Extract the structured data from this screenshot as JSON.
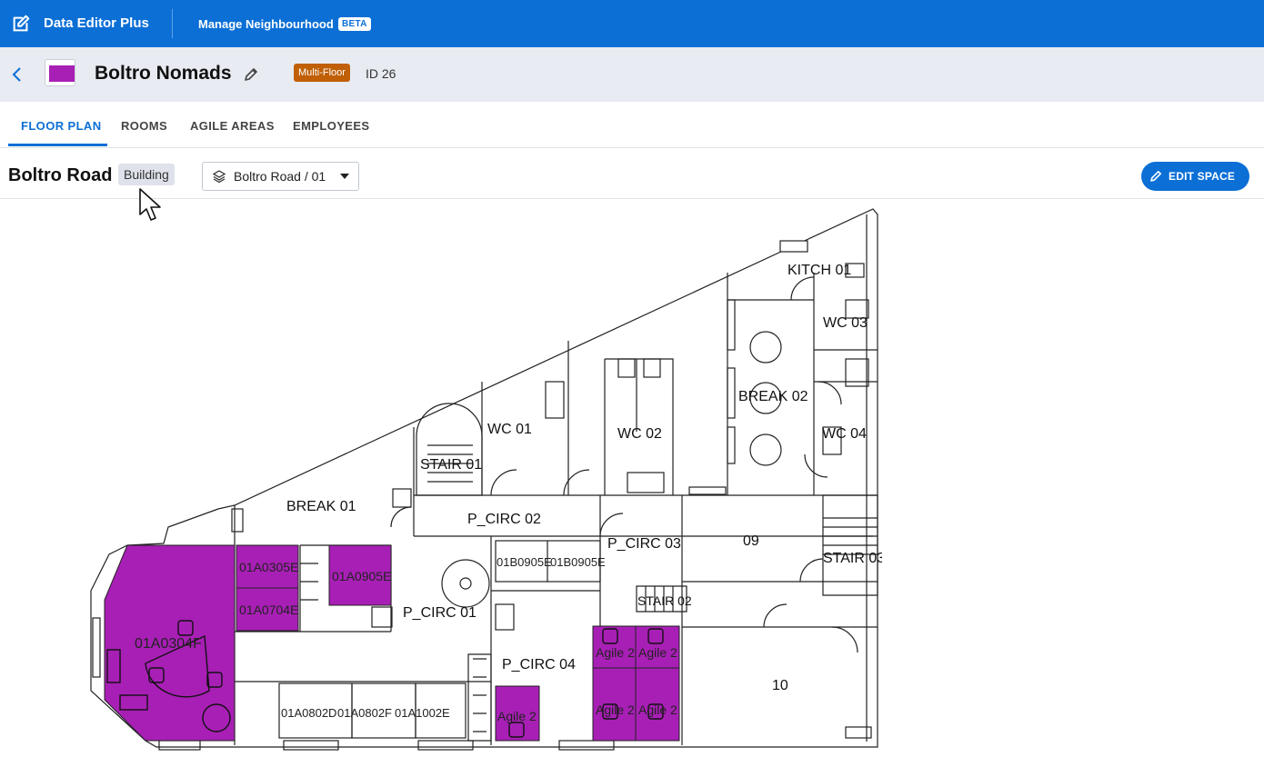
{
  "topbar": {
    "app_title": "Data Editor Plus",
    "nav_item": "Manage Neighbourhood",
    "beta_badge": "BETA",
    "bg_color": "#0b6fd6"
  },
  "header": {
    "title": "Boltro Nomads",
    "swatch_color": "#a81fb5",
    "type_badge": "Multi-Floor",
    "id_label": "ID 26"
  },
  "tabs": [
    {
      "label": "FLOOR PLAN",
      "active": true
    },
    {
      "label": "ROOMS",
      "active": false
    },
    {
      "label": "AGILE AREAS",
      "active": false
    },
    {
      "label": "EMPLOYEES",
      "active": false
    }
  ],
  "subbar": {
    "building_name": "Boltro Road",
    "building_chip": "Building",
    "floor_selector": "Boltro Road / 01",
    "edit_button": "EDIT SPACE"
  },
  "floorplan": {
    "highlight_color": "#a81fb5",
    "rooms": {
      "kitch01": "KITCH 01",
      "wc03": "WC 03",
      "break02": "BREAK 02",
      "wc04": "WC 04",
      "wc01": "WC 01",
      "wc02": "WC 02",
      "stair01": "STAIR 01",
      "break01": "BREAK 01",
      "pcirc02": "P_CIRC 02",
      "pcirc03": "P_CIRC 03",
      "r09": "09",
      "stair03": "STAIR 03",
      "stair02": "STAIR 02",
      "pcirc01": "P_CIRC 01",
      "pcirc04": "P_CIRC 04",
      "r10": "10"
    },
    "desks": {
      "d01A0305E": "01A0305E",
      "d01A0704E": "01A0704E",
      "d01A0905E": "01A0905E",
      "d01A0304F": "01A0304F",
      "d01B0905E_1": "01B0905E",
      "d01B0905E_2": "01B0905E",
      "d01A0802D": "01A0802D",
      "d01A0802F": "01A0802F",
      "d01A1002E": "01A1002E",
      "agile_1": "Agile 2",
      "agile_2": "Agile 2",
      "agile_3": "Agile 2",
      "agile_4": "Agile 2",
      "agile_5": "Agile 2"
    }
  }
}
